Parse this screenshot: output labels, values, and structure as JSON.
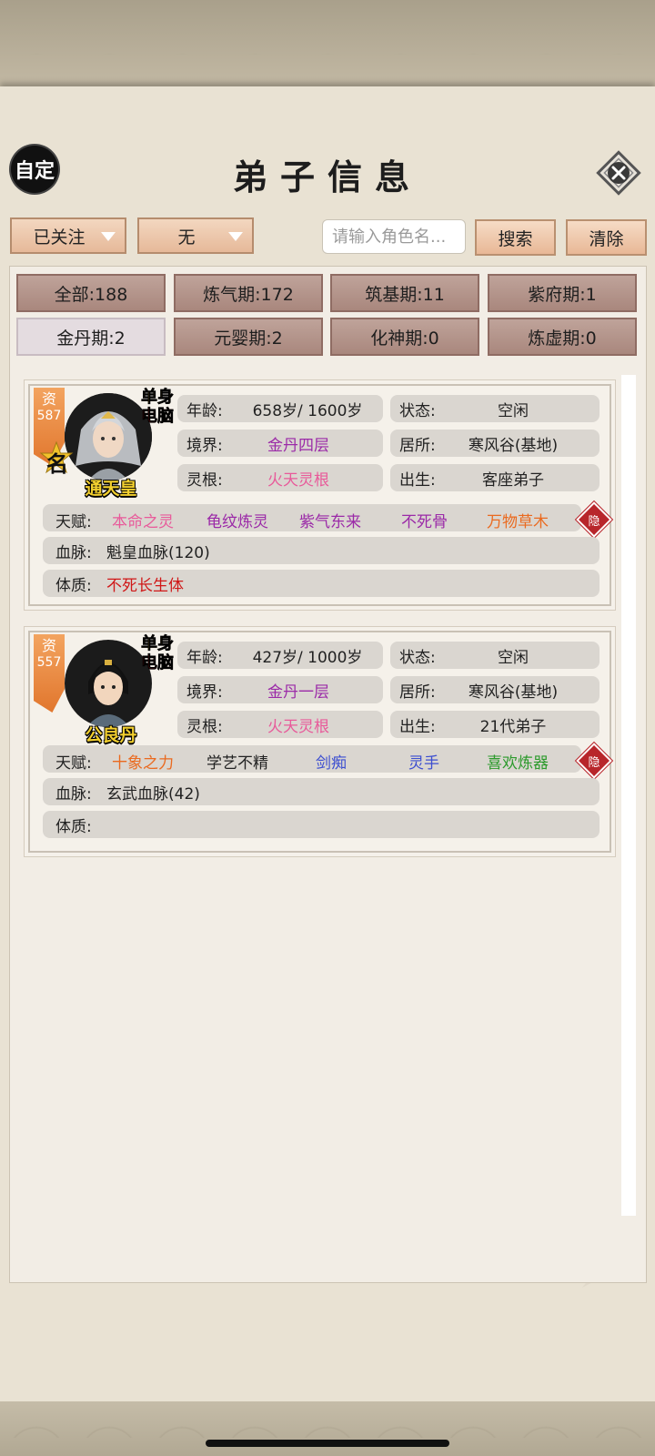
{
  "header": {
    "custom_label": "自定",
    "title": "弟子信息",
    "close_icon": "close-icon"
  },
  "filters": {
    "follow_dropdown": "已关注",
    "second_dropdown": "无",
    "search_placeholder": "请输入角色名...",
    "search_label": "搜索",
    "clear_label": "清除"
  },
  "realm_tabs": [
    {
      "label": "全部:188",
      "active": false
    },
    {
      "label": "炼气期:172",
      "active": false
    },
    {
      "label": "筑基期:11",
      "active": false
    },
    {
      "label": "紫府期:1",
      "active": false
    },
    {
      "label": "金丹期:2",
      "active": true
    },
    {
      "label": "元婴期:2",
      "active": false
    },
    {
      "label": "化神期:0",
      "active": false
    },
    {
      "label": "炼虚期:0",
      "active": false
    }
  ],
  "disciples": [
    {
      "aptitude_label": "资",
      "aptitude": "587",
      "tag_top": "单身",
      "tag_bottom": "电脑",
      "fame": "名",
      "name": "通天皇",
      "age_label": "年龄:",
      "age": "658岁/ 1600岁",
      "status_label": "状态:",
      "status": "空闲",
      "realm_label": "境界:",
      "realm": "金丹四层",
      "residence_label": "居所:",
      "residence": "寒风谷(基地)",
      "root_label": "灵根:",
      "root": "火天灵根",
      "origin_label": "出生:",
      "origin": "客座弟子",
      "talent_label": "天赋:",
      "talents": [
        {
          "text": "本命之灵",
          "color": "#e85a9a"
        },
        {
          "text": "龟纹炼灵",
          "color": "#9b2aa8"
        },
        {
          "text": "紫气东来",
          "color": "#9b2aa8"
        },
        {
          "text": "不死骨",
          "color": "#9b2aa8"
        },
        {
          "text": "万物草木",
          "color": "#ea6a1f"
        }
      ],
      "hide_label": "隐",
      "bloodline_label": "血脉:",
      "bloodline": "魁皇血脉(120)",
      "physique_label": "体质:",
      "physique": "不死长生体",
      "physique_color": "#d01818"
    },
    {
      "aptitude_label": "资",
      "aptitude": "557",
      "tag_top": "单身",
      "tag_bottom": "电脑",
      "fame": "",
      "name": "公良丹",
      "age_label": "年龄:",
      "age": "427岁/ 1000岁",
      "status_label": "状态:",
      "status": "空闲",
      "realm_label": "境界:",
      "realm": "金丹一层",
      "residence_label": "居所:",
      "residence": "寒风谷(基地)",
      "root_label": "灵根:",
      "root": "火天灵根",
      "origin_label": "出生:",
      "origin": "21代弟子",
      "talent_label": "天赋:",
      "talents": [
        {
          "text": "十象之力",
          "color": "#ea6a1f"
        },
        {
          "text": "学艺不精",
          "color": "#222222"
        },
        {
          "text": "剑痴",
          "color": "#3c4ed0"
        },
        {
          "text": "灵手",
          "color": "#3c4ed0"
        },
        {
          "text": "喜欢炼器",
          "color": "#2c9a2c"
        }
      ],
      "hide_label": "隐",
      "bloodline_label": "血脉:",
      "bloodline": "玄武血脉(42)",
      "physique_label": "体质:",
      "physique": "",
      "physique_color": "#d01818"
    }
  ],
  "colors": {
    "realm_text": "#9b2aa8",
    "root_text": "#e85a9a",
    "name_text": "#f2cf2f"
  }
}
